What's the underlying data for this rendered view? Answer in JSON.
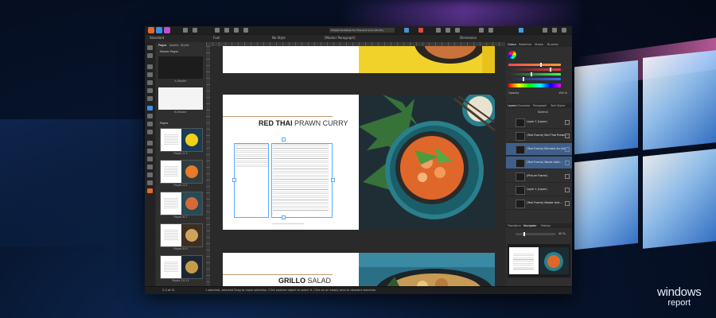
{
  "app": {
    "document_title": "Simple Cookbook for Thai and Cura (39.4%)",
    "context_bar": {
      "studio_label": "Standard",
      "font_name": "Fuel",
      "style_name": "No Style",
      "paragraph_style": "[Master Paragraph]",
      "zoom_label": "Dimension"
    }
  },
  "pages_panel": {
    "tabs": [
      "Pages",
      "Assets",
      "Styles"
    ],
    "master_pages_label": "Master Pages",
    "masters": [
      {
        "label": "A-Master"
      },
      {
        "label": "B-Master"
      }
    ],
    "pages_label": "Pages",
    "spreads": [
      {
        "caption": "Pages 2-3",
        "left": "#ffffff",
        "right": "#1a3b55",
        "accent": "#f2d01a"
      },
      {
        "caption": "Pages 4-5",
        "left": "#ffffff",
        "right": "#2c3e40",
        "accent": "#e87a2a"
      },
      {
        "caption": "Pages 6-7",
        "left": "#ffffff",
        "right": "#264a56",
        "accent": "#d5693a"
      },
      {
        "caption": "Pages 8-9",
        "left": "#ffffff",
        "right": "#3b2e25",
        "accent": "#cfa35a"
      },
      {
        "caption": "Pages 10-11",
        "left": "#ffffff",
        "right": "#1b2730",
        "accent": "#c89b4a"
      }
    ]
  },
  "canvas": {
    "spread_main": {
      "heading_bold": "RED THAI",
      "heading_light": "PRAWN CURRY"
    },
    "spread_bottom": {
      "heading_bold": "GRILLO",
      "heading_light": "SALAD"
    },
    "colors": {
      "rule": "#c49a6c",
      "yellow": "#f0d22a",
      "food_dark": "#1d2c33",
      "bowl_teal": "#2a7f8c",
      "curry": "#e0672a"
    }
  },
  "right_panels": {
    "colour_tabs": [
      "Colour",
      "Swatches",
      "Stroke",
      "Brushes"
    ],
    "opacity_label": "Opacity",
    "opacity_value": "100 %",
    "layer_tabs": [
      "Layers",
      "Character",
      "Paragraph",
      "Text Styles"
    ],
    "blend_label": "Normal",
    "layers": [
      {
        "name": "Layer 1 (Layer)",
        "selected": false
      },
      {
        "name": "(Text Frame) Red Thai Prawn...",
        "selected": false
      },
      {
        "name": "(Text Frame) Blended Acrylic...",
        "selected": true
      },
      {
        "name": "(Text Frame) Words Italic...",
        "selected": true
      },
      {
        "name": "(Picture Frame)",
        "selected": false
      },
      {
        "name": "Layer 1 (Layer)",
        "selected": false
      },
      {
        "name": "(Text Frame) Master text...",
        "selected": false
      }
    ],
    "nav_tabs": [
      "Transform",
      "Navigator",
      "History"
    ],
    "zoom_value": "40 %"
  },
  "status": {
    "page_count": "2-3 of 11",
    "message": "1 selected, selected Drag to move selection. Click another object to select it. Click on an empty area to deselect selection."
  },
  "brand": {
    "line1": "windows",
    "line2": "report"
  }
}
